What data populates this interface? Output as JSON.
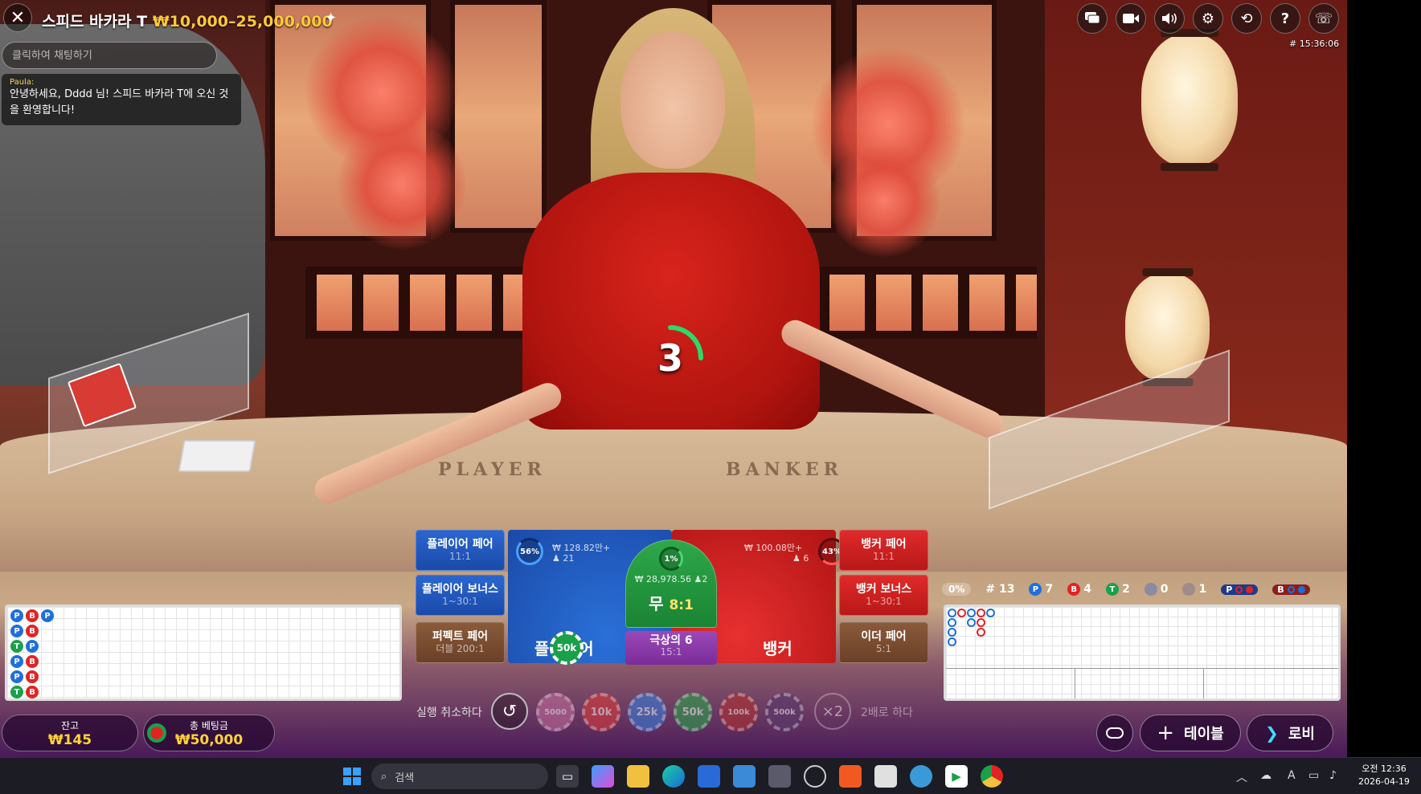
{
  "header": {
    "title": "스피드 바카라 T",
    "limits": "₩10,000–25,000,000",
    "clock": "# 15:36:06"
  },
  "chat": {
    "placeholder": "클릭하여 채팅하기",
    "author": "Paula:",
    "message": "안녕하세요, Dddd 님! 스피드 바카라 T에 오신 것을 환영합니다!"
  },
  "countdown": "3",
  "table_print": {
    "player": "PLAYER",
    "banker": "BANKER"
  },
  "bets": {
    "player_pair": {
      "label": "플레이어 페어",
      "payout": "11:1"
    },
    "player_bonus": {
      "label": "플레이어 보너스",
      "payout": "1~30:1"
    },
    "perfect_pair": {
      "label": "퍼펙트 페어",
      "payout": "더블 200:1"
    },
    "banker_pair": {
      "label": "뱅커 페어",
      "payout": "11:1"
    },
    "banker_bonus": {
      "label": "뱅커 보너스",
      "payout": "1~30:1"
    },
    "either_pair": {
      "label": "이더 페어",
      "payout": "5:1"
    },
    "player": {
      "label": "플레이어",
      "pct": "56%",
      "pool": "₩ 128.82만+",
      "players": "21"
    },
    "banker": {
      "label": "뱅커",
      "pct": "43%",
      "pool": "₩ 100.08만+",
      "players": "6"
    },
    "tie": {
      "label": "무",
      "payout": "8:1",
      "pct": "1%",
      "pool": "₩ 28,978.56",
      "players": "2"
    },
    "super6": {
      "label": "극상의 6",
      "payout": "15:1"
    },
    "placed_chip": "50k"
  },
  "chips": {
    "undo_label": "실행 취소하다",
    "values": [
      "5000",
      "10k",
      "25k",
      "50k",
      "100k",
      "500k"
    ],
    "colors": [
      "#c06a9a",
      "#d83a3a",
      "#3a7ad8",
      "#2aa04a",
      "#b03030",
      "#5a3a6a"
    ],
    "double_symbol": "×2",
    "double_label": "2배로 하다"
  },
  "balance": {
    "label": "잔고",
    "value": "₩145"
  },
  "total_bet": {
    "label": "총 베팅금",
    "value": "₩50,000"
  },
  "nav": {
    "table": "테이블",
    "lobby": "로비"
  },
  "stats": {
    "pct": "0%",
    "round": "# 13",
    "player_count": "7",
    "banker_count": "4",
    "tie_count": "2",
    "player_pair_count": "0",
    "banker_pair_count": "1",
    "p_letter": "P",
    "b_letter": "B",
    "t_letter": "T"
  },
  "bead_road": [
    [
      "P",
      "P",
      "T",
      "P",
      "P",
      "T"
    ],
    [
      "B",
      "B",
      "P",
      "B",
      "B",
      "B"
    ],
    [
      "P"
    ]
  ],
  "top_icons": [
    "chat-icon",
    "video-icon",
    "sound-icon",
    "settings-icon",
    "history-icon",
    "help-icon",
    "support-icon"
  ],
  "taskbar": {
    "search": "검색",
    "time": "오전 12:36",
    "date": "2026-04-19",
    "ime": "A"
  }
}
